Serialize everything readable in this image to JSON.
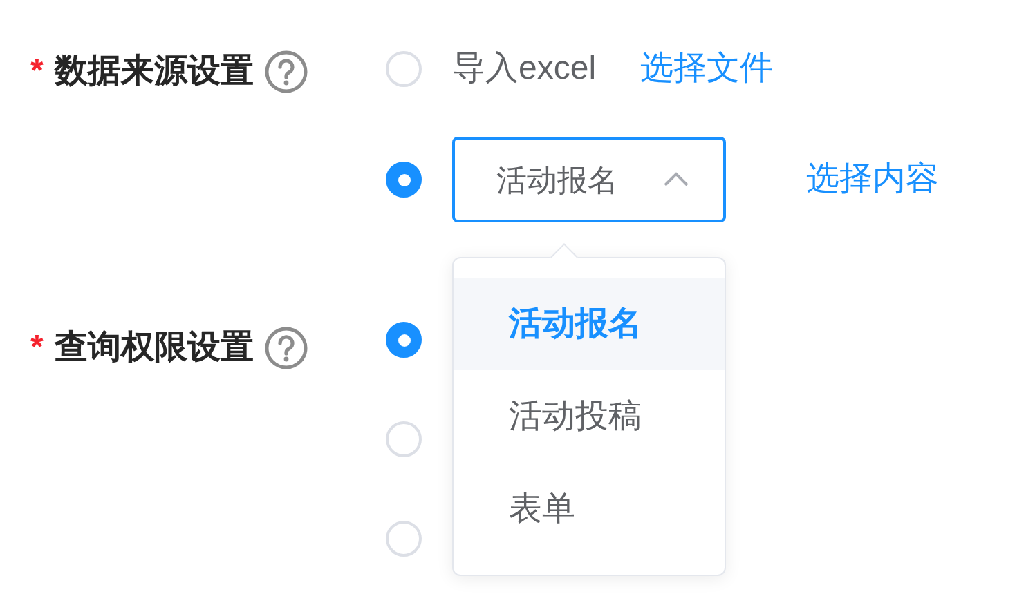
{
  "fields": [
    {
      "required_mark": "*",
      "label": "数据来源设置",
      "options": [
        {
          "kind": "text",
          "selected": false,
          "text": "导入excel",
          "link": "选择文件"
        },
        {
          "kind": "select",
          "selected": true,
          "value": "活动报名",
          "expanded": true,
          "link": "选择内容",
          "menu": [
            {
              "label": "活动报名",
              "selected": true
            },
            {
              "label": "活动投稿",
              "selected": false
            },
            {
              "label": "表单",
              "selected": false
            }
          ]
        }
      ]
    },
    {
      "required_mark": "*",
      "label": "查询权限设置",
      "options": [
        {
          "kind": "blank",
          "selected": true
        },
        {
          "kind": "blank",
          "selected": false
        },
        {
          "kind": "blank",
          "selected": false
        }
      ]
    }
  ]
}
